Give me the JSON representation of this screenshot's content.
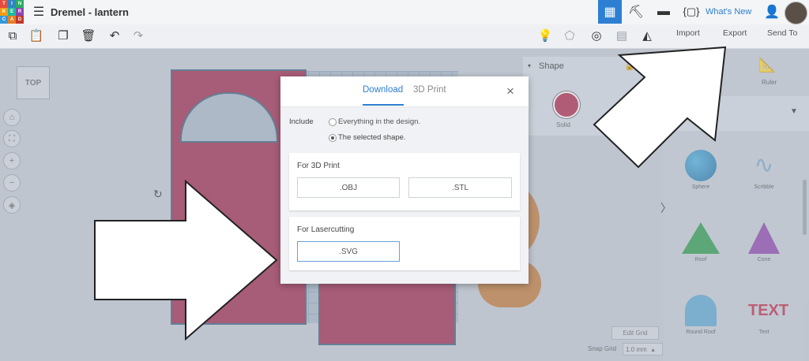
{
  "app": {
    "title": "Dremel - lantern",
    "logo_letters": [
      "T",
      "I",
      "N",
      "K",
      "E",
      "R",
      "C",
      "A",
      "D"
    ],
    "whats_new": "What's New"
  },
  "toolbar": {
    "import_label": "Import",
    "export_label": "Export",
    "send_to_label": "Send To"
  },
  "workspace": {
    "view_cube_label": "TOP",
    "edit_grid_label": "Edit Grid",
    "snap_grid_label": "Snap Grid",
    "snap_grid_value": "1.0 mm"
  },
  "shape_panel": {
    "header": "Shape",
    "solid_label": "Solid",
    "solid_color": "#b0294a"
  },
  "right_panel": {
    "ruler_label": "Ruler",
    "shapes": [
      {
        "label": "Sphere",
        "icon": "sphere-icon"
      },
      {
        "label": "Scribble",
        "icon": "scribble-icon"
      },
      {
        "label": "Roof",
        "icon": "roof-icon"
      },
      {
        "label": "Cone",
        "icon": "cone-icon"
      },
      {
        "label": "Round Roof",
        "icon": "round-roof-icon"
      },
      {
        "label": "Text",
        "icon": "text-icon"
      }
    ]
  },
  "modal": {
    "tabs": [
      "Download",
      "3D Print"
    ],
    "active_tab": "Download",
    "include_label": "Include",
    "option_all": "Everything in the design.",
    "option_selected": "The selected shape.",
    "print_section_title": "For 3D Print",
    "obj_label": ".OBJ",
    "stl_label": ".STL",
    "laser_section_title": "For Lasercutting",
    "svg_label": ".SVG",
    "close_icon": "×"
  },
  "colors": {
    "accent": "#2d7fd3",
    "design_red": "#a0294c",
    "orange": "#c27a3a"
  }
}
